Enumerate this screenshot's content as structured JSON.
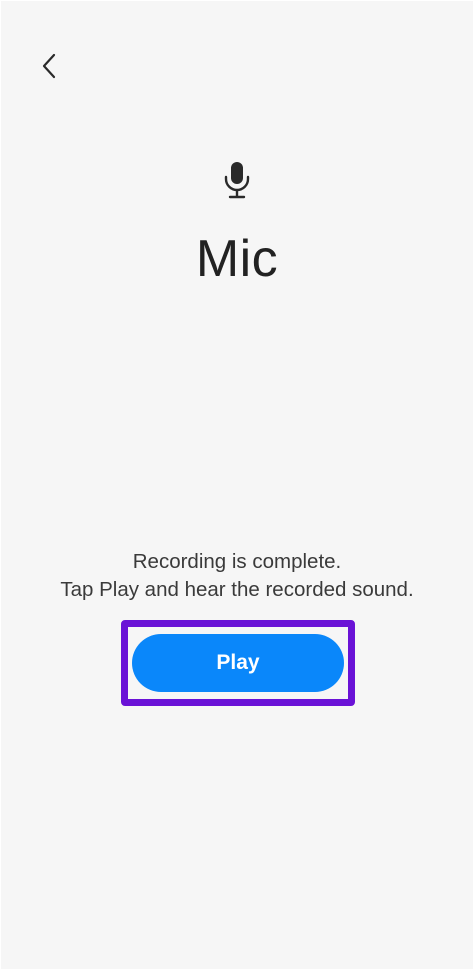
{
  "header": {
    "back_icon": "chevron-left-icon"
  },
  "hero": {
    "icon": "microphone-icon",
    "title": "Mic"
  },
  "message": {
    "line1": "Recording is complete.",
    "line2": "Tap Play and hear the recorded sound."
  },
  "actions": {
    "play_label": "Play"
  },
  "colors": {
    "background": "#f6f6f6",
    "play_button": "#0a87fa",
    "highlight_outline": "#6a12d6",
    "text": "#222222"
  }
}
